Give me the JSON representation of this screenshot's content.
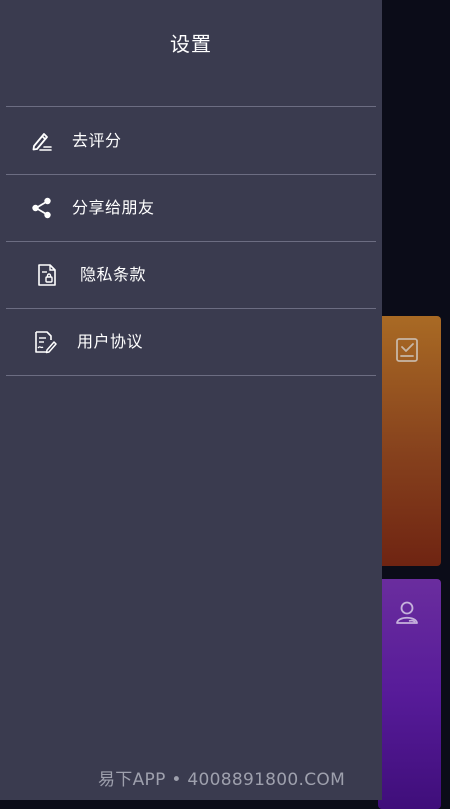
{
  "drawer": {
    "title": "设置",
    "items": [
      {
        "label": "去评分",
        "icon": "pen-rating-icon"
      },
      {
        "label": "分享给朋友",
        "icon": "share-icon"
      },
      {
        "label": "隐私条款",
        "icon": "privacy-document-icon"
      },
      {
        "label": "用户协议",
        "icon": "agreement-document-icon"
      }
    ]
  },
  "background": {
    "cards": [
      {
        "icon": "checklist-card-icon",
        "color": "#86411d"
      },
      {
        "icon": "user-profile-icon",
        "color": "#571b99"
      }
    ]
  },
  "colors": {
    "drawer_bg": "#3a3b4f",
    "backdrop": "#0b0c18",
    "divider": "#6c6d82",
    "text": "#ffffff"
  },
  "watermark": "易下APP • 4008891800.COM"
}
